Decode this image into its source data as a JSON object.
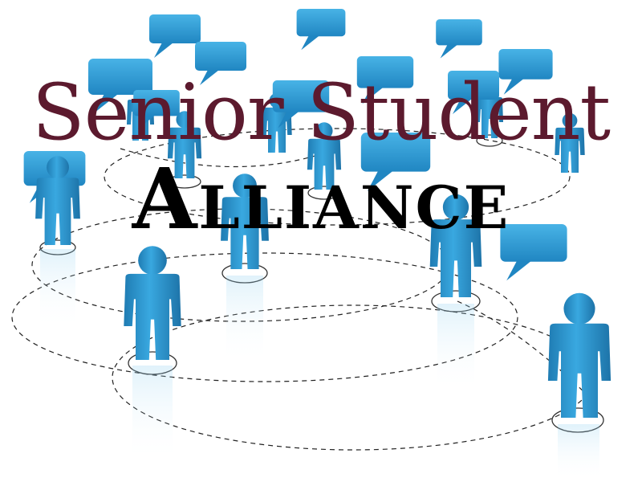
{
  "title": {
    "line1": "Senior Student",
    "line2": "Alliance"
  },
  "colors": {
    "line1": "#5c1a2e",
    "line2": "#000000",
    "figure": "#2e9ad4",
    "figure_dark": "#1f7cb3",
    "bubble": "#2f9fd8"
  }
}
